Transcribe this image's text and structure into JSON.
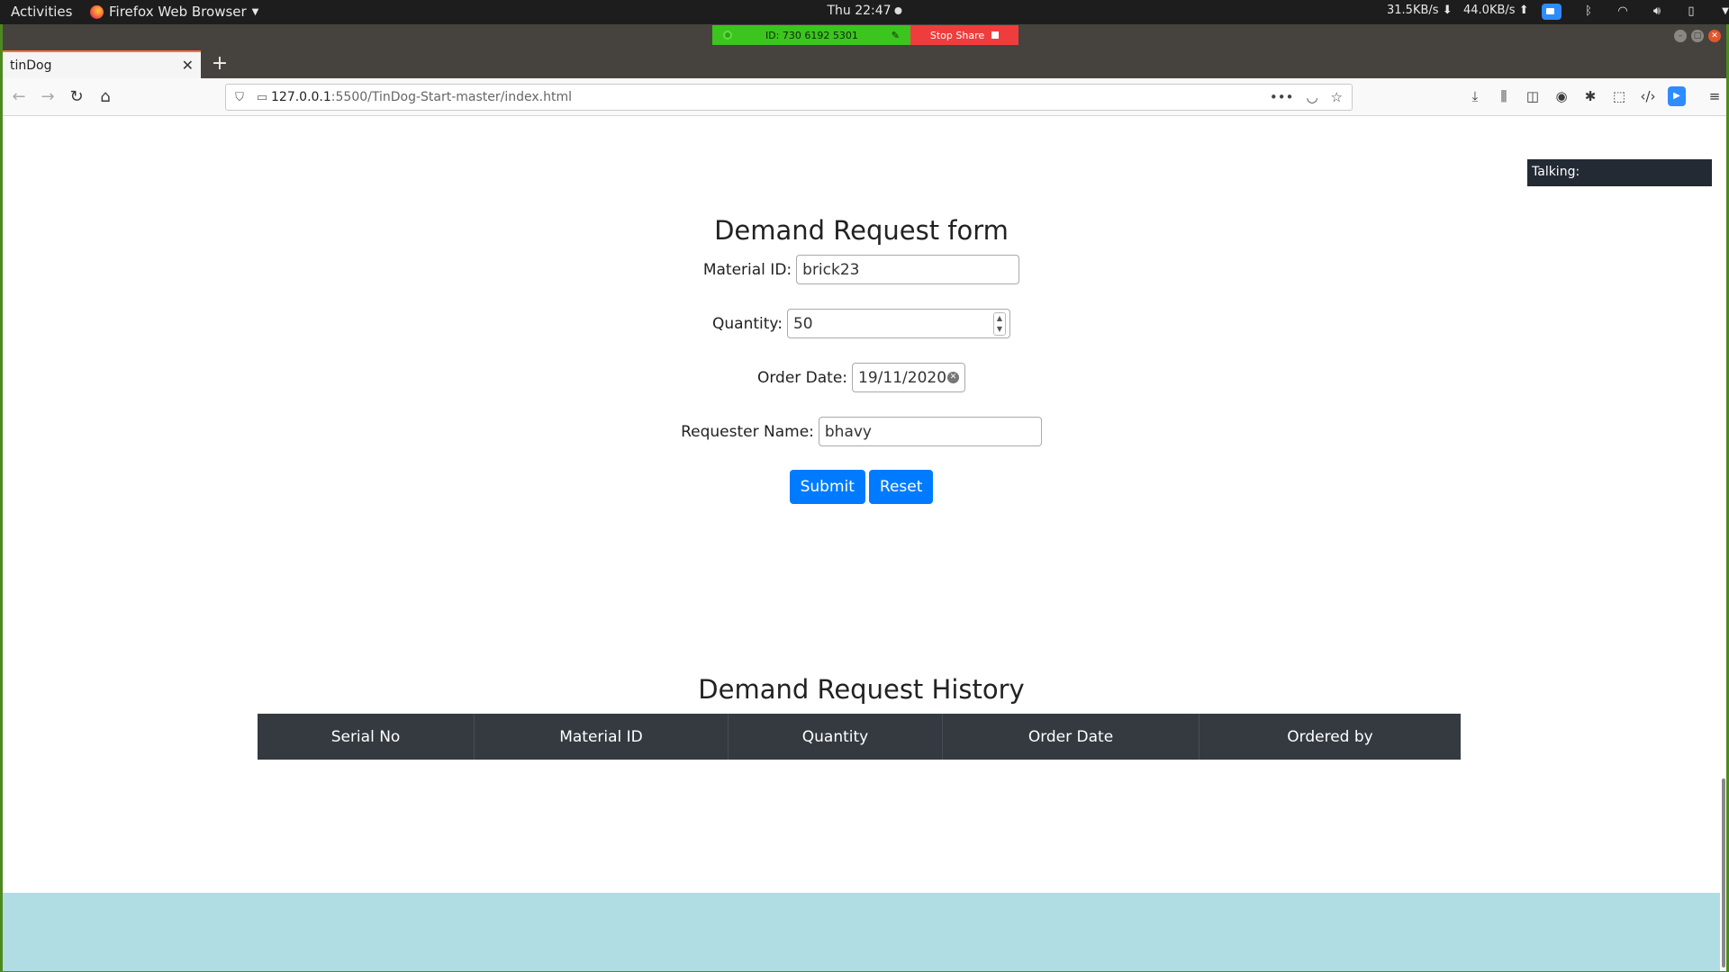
{
  "topbar": {
    "activities": "Activities",
    "app_name": "Firefox Web Browser",
    "clock": "Thu 22:47",
    "net_down": "31.5KB/s",
    "net_up": "44.0KB/s"
  },
  "screen_share": {
    "meeting_id": "ID: 730 6192 5301",
    "stop_label": "Stop Share"
  },
  "browser": {
    "tab_title": "tinDog",
    "new_tab": "+",
    "url_host": "127.0.0.1",
    "url_rest": ":5500/TinDog-Start-master/index.html"
  },
  "overlay": {
    "talking": "Talking:"
  },
  "form": {
    "title": "Demand Request form",
    "material_label": "Material ID:",
    "material_value": "brick23",
    "quantity_label": "Quantity:",
    "quantity_value": "50",
    "date_label": "Order Date:",
    "date_value": "19/11/2020",
    "requester_label": "Requester Name:",
    "requester_value": "bhavy",
    "submit_label": "Submit",
    "reset_label": "Reset"
  },
  "history": {
    "title": "Demand Request History",
    "columns": [
      "Serial No",
      "Material ID",
      "Quantity",
      "Order Date",
      "Ordered by"
    ]
  },
  "colors": {
    "primary_button": "#007bff",
    "table_header": "#343a40",
    "footer_band": "#b0dde4",
    "share_green": "#3cc41f",
    "share_red": "#ef3d3d"
  }
}
